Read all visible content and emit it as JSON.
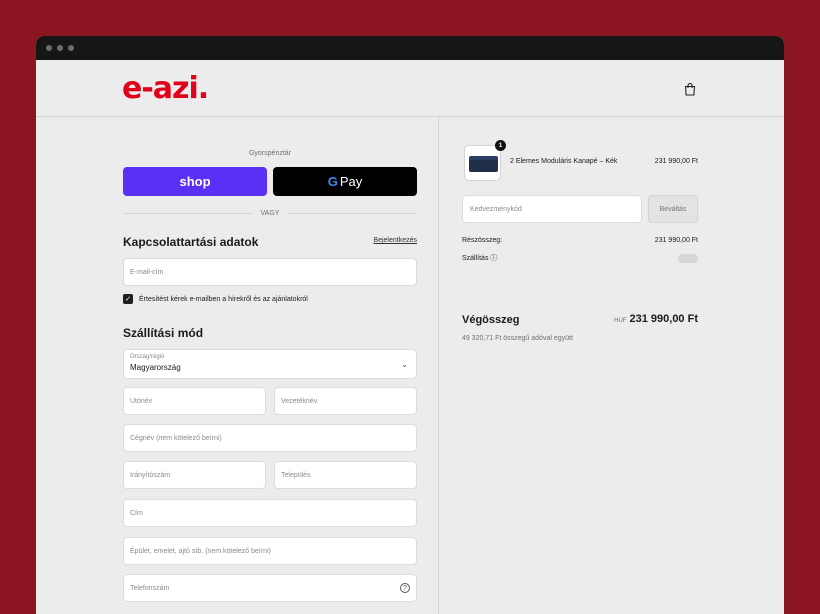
{
  "brand": {
    "logo_text": "e-azi.",
    "accent": "#e2001a"
  },
  "header": {
    "cart_icon": "shopping-bag-icon"
  },
  "express": {
    "label": "Gyorspénztár",
    "shop_label": "shop",
    "gpay_g": "G",
    "gpay_label": "Pay",
    "or_label": "VAGY"
  },
  "contact": {
    "title": "Kapcsolattartási adatok",
    "login_link": "Bejelentkezés",
    "email_placeholder": "E-mail-cím",
    "newsletter_label": "Értesítést kérek e-mailben a hírekről és az ajánlatokról"
  },
  "shipping": {
    "title": "Szállítási mód",
    "country_label": "Ország/régió",
    "country_value": "Magyarország",
    "first_name": "Utónév",
    "last_name": "Vezetéknév",
    "company": "Cégnév (nem kötelező beírni)",
    "postcode": "Irányítószám",
    "city": "Település",
    "address": "Cím",
    "address2": "Épület, emelet, ajtó stb. (nem kötelező beírni)",
    "phone": "Telefonszám"
  },
  "summary": {
    "product_name": "2 Elemes Moduláris Kanapé – Kék",
    "product_price": "231 990,00 Ft",
    "quantity": "1",
    "discount_placeholder": "Kedvezménykód",
    "apply_label": "Beváltás",
    "subtotal_label": "Részösszeg:",
    "subtotal_value": "231 990,00 Ft",
    "shipping_label": "Szállítás",
    "total_label": "Végösszeg",
    "currency": "HUF",
    "total_value": "231 990,00 Ft",
    "tax_note": "49 320,71 Ft összegű adóval együtt"
  }
}
